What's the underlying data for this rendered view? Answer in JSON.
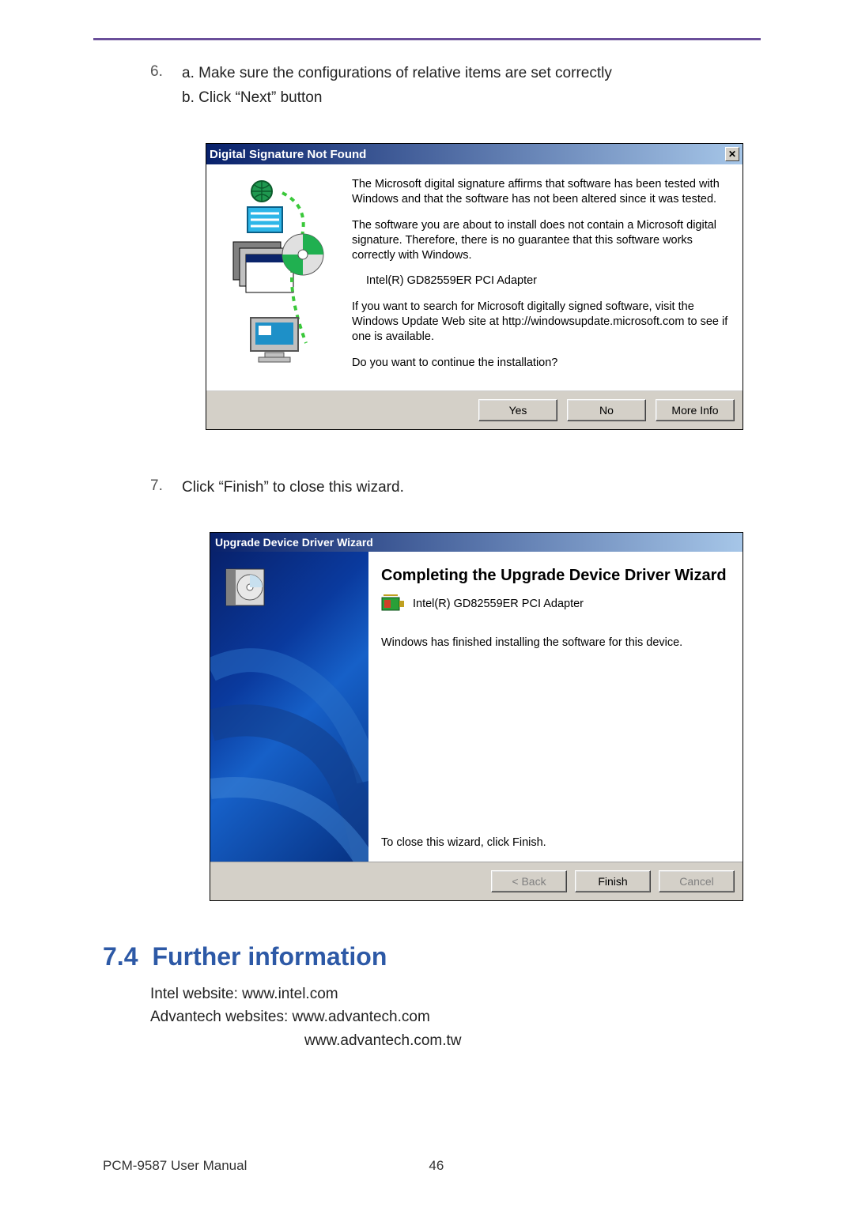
{
  "steps": {
    "six": {
      "num": "6.",
      "line_a": "a. Make sure the configurations of relative items are set correctly",
      "line_b": "b. Click “Next” button"
    },
    "seven": {
      "num": "7.",
      "text": "Click “Finish” to close this wizard."
    }
  },
  "dialog1": {
    "title": "Digital Signature Not Found",
    "close_symbol": "✕",
    "p1": "The Microsoft digital signature affirms that software has been tested with Windows and that the software has not been altered since it was tested.",
    "p2": "The software you are about to install does not contain a Microsoft digital signature. Therefore,  there is no guarantee that this software works correctly with Windows.",
    "device": "Intel(R) GD82559ER PCI Adapter",
    "p3": "If you want to search for Microsoft digitally signed software, visit the Windows Update Web site at http://windowsupdate.microsoft.com to see if one is available.",
    "p4": "Do you want to continue the installation?",
    "buttons": {
      "yes": "Yes",
      "no": "No",
      "more": "More Info"
    }
  },
  "dialog2": {
    "title": "Upgrade Device Driver Wizard",
    "heading": "Completing the Upgrade Device Driver Wizard",
    "device": "Intel(R) GD82559ER PCI Adapter",
    "finished": "Windows has finished installing the software for this device.",
    "close_hint": "To close this wizard, click Finish.",
    "buttons": {
      "back": "< Back",
      "finish": "Finish",
      "cancel": "Cancel"
    }
  },
  "section74": {
    "num": "7.4",
    "title": "Further information",
    "line1": "Intel website: www.intel.com",
    "line2": "Advantech websites: www.advantech.com",
    "line3": "www.advantech.com.tw"
  },
  "footer": {
    "manual": "PCM-9587 User Manual",
    "page": "46"
  }
}
